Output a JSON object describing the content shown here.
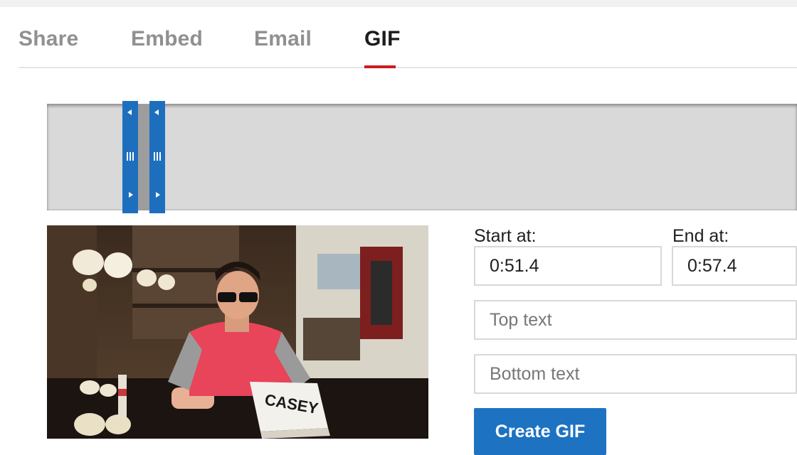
{
  "tabs": {
    "share": "Share",
    "embed": "Embed",
    "email": "Email",
    "gif": "GIF",
    "active": "GIF",
    "active_underline_color": "#cc1b22"
  },
  "preview": {
    "book_text": "CASEY"
  },
  "form": {
    "start_label": "Start at:",
    "start_value": "0:51.4",
    "end_label": "End at:",
    "end_value": "0:57.4",
    "top_text_placeholder": "Top text",
    "bottom_text_placeholder": "Bottom text",
    "create_button": "Create GIF"
  },
  "colors": {
    "accent_blue": "#1d72c2",
    "handle_blue": "#1d6fbe"
  }
}
